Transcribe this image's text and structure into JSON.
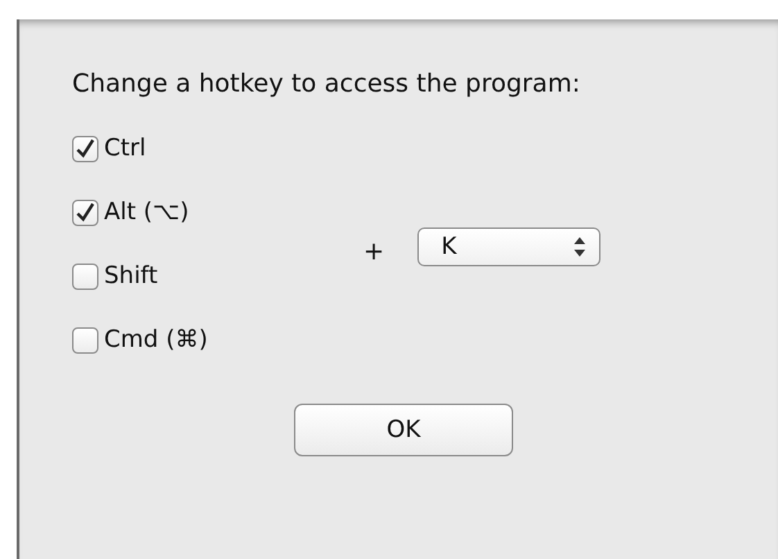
{
  "dialog": {
    "title": "Change a hotkey to access the program:",
    "modifiers": [
      {
        "label": "Ctrl",
        "checked": true
      },
      {
        "label": "Alt (⌥)",
        "checked": true
      },
      {
        "label": "Shift",
        "checked": false
      },
      {
        "label": "Cmd (⌘)",
        "checked": false
      }
    ],
    "plus": "+",
    "key": {
      "value": "K"
    },
    "buttons": [
      "OK"
    ]
  }
}
